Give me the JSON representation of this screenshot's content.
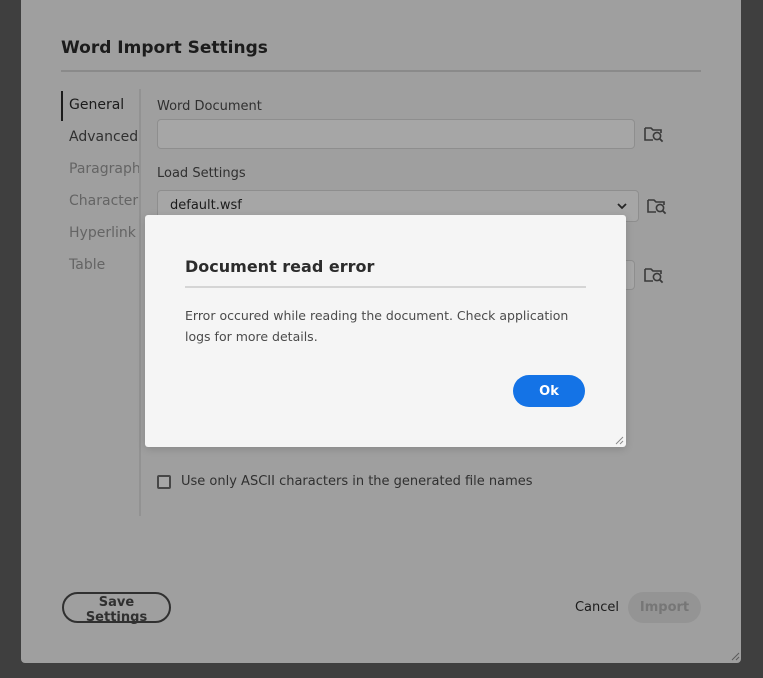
{
  "main": {
    "title": "Word Import Settings",
    "nav": [
      {
        "label": "General",
        "state": "active"
      },
      {
        "label": "Advanced",
        "state": "enabled"
      },
      {
        "label": "Paragraph",
        "state": "disabled"
      },
      {
        "label": "Character",
        "state": "disabled"
      },
      {
        "label": "Hyperlink",
        "state": "disabled"
      },
      {
        "label": "Table",
        "state": "disabled"
      }
    ],
    "word_document_label": "Word Document",
    "word_document_value": "",
    "load_settings_label": "Load Settings",
    "load_settings_value": "default.wsf",
    "ascii_checkbox_label": "Use only ASCII characters in the generated file names",
    "save_settings_label": "Save Settings",
    "cancel_label": "Cancel",
    "import_label": "Import"
  },
  "modal": {
    "title": "Document read error",
    "message": "Error occured while reading the document. Check application logs for more details.",
    "ok_label": "Ok"
  },
  "colors": {
    "accent": "#1473e6",
    "backdrop": "#626262",
    "panel": "#f5f5f5"
  },
  "icons": {
    "browse": "folder-search-icon",
    "dropdown": "chevron-down-icon",
    "resize": "resize-grip-icon"
  }
}
